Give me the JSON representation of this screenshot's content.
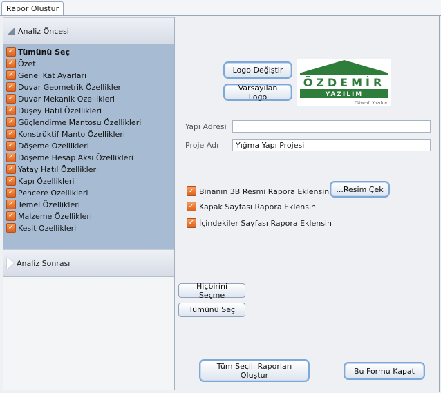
{
  "tab": {
    "label": "Rapor Oluştur"
  },
  "left_panel": {
    "pre_header": "Analiz Öncesi",
    "post_header": "Analiz Sonrası",
    "items": [
      {
        "label": "Tümünü Seç",
        "checked": true,
        "bold": true
      },
      {
        "label": "Özet",
        "checked": true
      },
      {
        "label": "Genel Kat Ayarları",
        "checked": true
      },
      {
        "label": "Duvar Geometrik Özellikleri",
        "checked": true
      },
      {
        "label": "Duvar Mekanik Özellikleri",
        "checked": true
      },
      {
        "label": "Düşey Hatıl Özellikleri",
        "checked": true
      },
      {
        "label": "Güçlendirme Mantosu Özellikleri",
        "checked": true
      },
      {
        "label": "Konstrüktif Manto Özellikleri",
        "checked": true
      },
      {
        "label": "Döşeme Özellikleri",
        "checked": true
      },
      {
        "label": "Döşeme Hesap Aksı Özellikleri",
        "checked": true
      },
      {
        "label": "Yatay Hatıl Özellikleri",
        "checked": true
      },
      {
        "label": "Kapı Özellikleri",
        "checked": true
      },
      {
        "label": "Pencere Özellikleri",
        "checked": true
      },
      {
        "label": "Temel Özellikleri",
        "checked": true
      },
      {
        "label": "Malzeme Özellikleri",
        "checked": true
      },
      {
        "label": "Kesit Özellikleri",
        "checked": true
      }
    ]
  },
  "logo": {
    "change_button": "Logo Değiştir",
    "default_button": "Varsayılan Logo",
    "brand_name": "ÖZDEMİR",
    "brand_sub": "YAZILIM",
    "brand_tagline": "Güvenli Yazılım",
    "brand_green": "#2f7d3a"
  },
  "form": {
    "address_label": "Yapı Adresi",
    "address_value": "",
    "project_label": "Proje Adı",
    "project_value": "Yığma Yapı Projesi"
  },
  "options": [
    {
      "label": "Binanın 3B Resmi Rapora  Eklensin",
      "checked": true
    },
    {
      "label": "Kapak Sayfası Rapora Eklensin",
      "checked": true
    },
    {
      "label": "İçindekiler Sayfası Rapora Eklensin",
      "checked": true
    }
  ],
  "buttons": {
    "capture": "...Resim Çek",
    "select_none": "Hiçbirini Seçme",
    "select_all": "Tümünü Seç",
    "generate": "Tüm Seçili Raporları Oluştur",
    "close": "Bu Formu Kapat"
  },
  "checkmark_glyph": "✓"
}
